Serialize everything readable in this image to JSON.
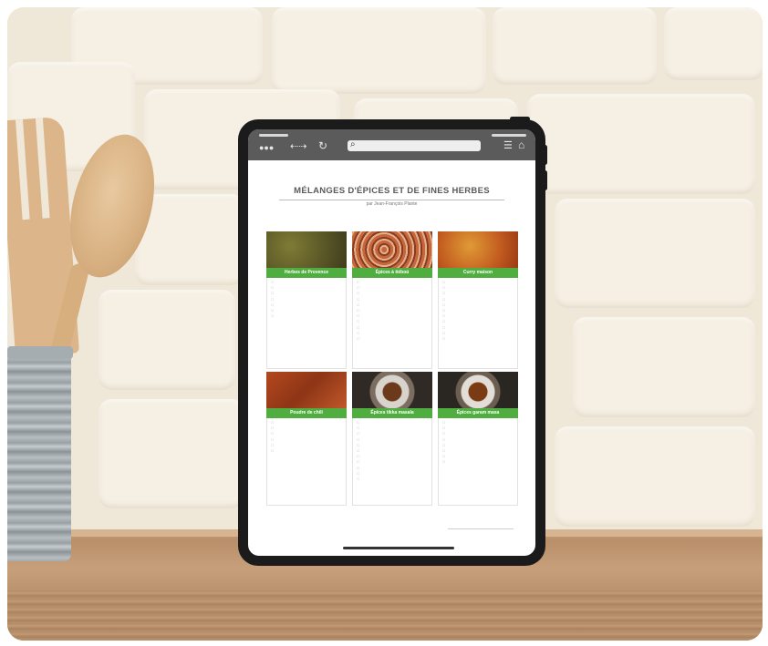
{
  "document": {
    "title": "MÉLANGES D'ÉPICES ET DE FINES HERBES",
    "subtitle": "par Jean-François Plante",
    "footer": "",
    "cards": [
      {
        "name": "Herbes de Provence",
        "swatch": "herbs",
        "items": [
          "",
          "",
          "",
          "",
          "",
          "",
          ""
        ]
      },
      {
        "name": "Épices à tiéboú",
        "swatch": "spice-mix",
        "items": [
          "",
          "",
          "",
          "",
          "",
          "",
          "",
          "",
          "",
          "",
          ""
        ]
      },
      {
        "name": "Curry maison",
        "swatch": "curry",
        "items": [
          "",
          "",
          "",
          "",
          "",
          "",
          "",
          "",
          "",
          "",
          ""
        ]
      },
      {
        "name": "Poudre de chili",
        "swatch": "chili",
        "items": [
          "",
          "",
          "",
          "",
          "",
          ""
        ]
      },
      {
        "name": "Épices tikka masala",
        "swatch": "mortar",
        "items": [
          "",
          "",
          "",
          "",
          "",
          "",
          "",
          "",
          "",
          "",
          ""
        ]
      },
      {
        "name": "Épices garam masa",
        "swatch": "mortar-dark",
        "items": [
          "",
          "",
          "",
          "",
          "",
          "",
          "",
          ""
        ]
      }
    ]
  },
  "browser": {
    "url": "",
    "icons": [
      "menu-dots-icon",
      "back-forward-icon",
      "reload-icon",
      "search-icon",
      "hamburger-icon",
      "home-icon"
    ]
  },
  "colors": {
    "header_green": "#4fae3f",
    "tablet_frame": "#1b1b1b",
    "wall": "#efe7d8"
  }
}
